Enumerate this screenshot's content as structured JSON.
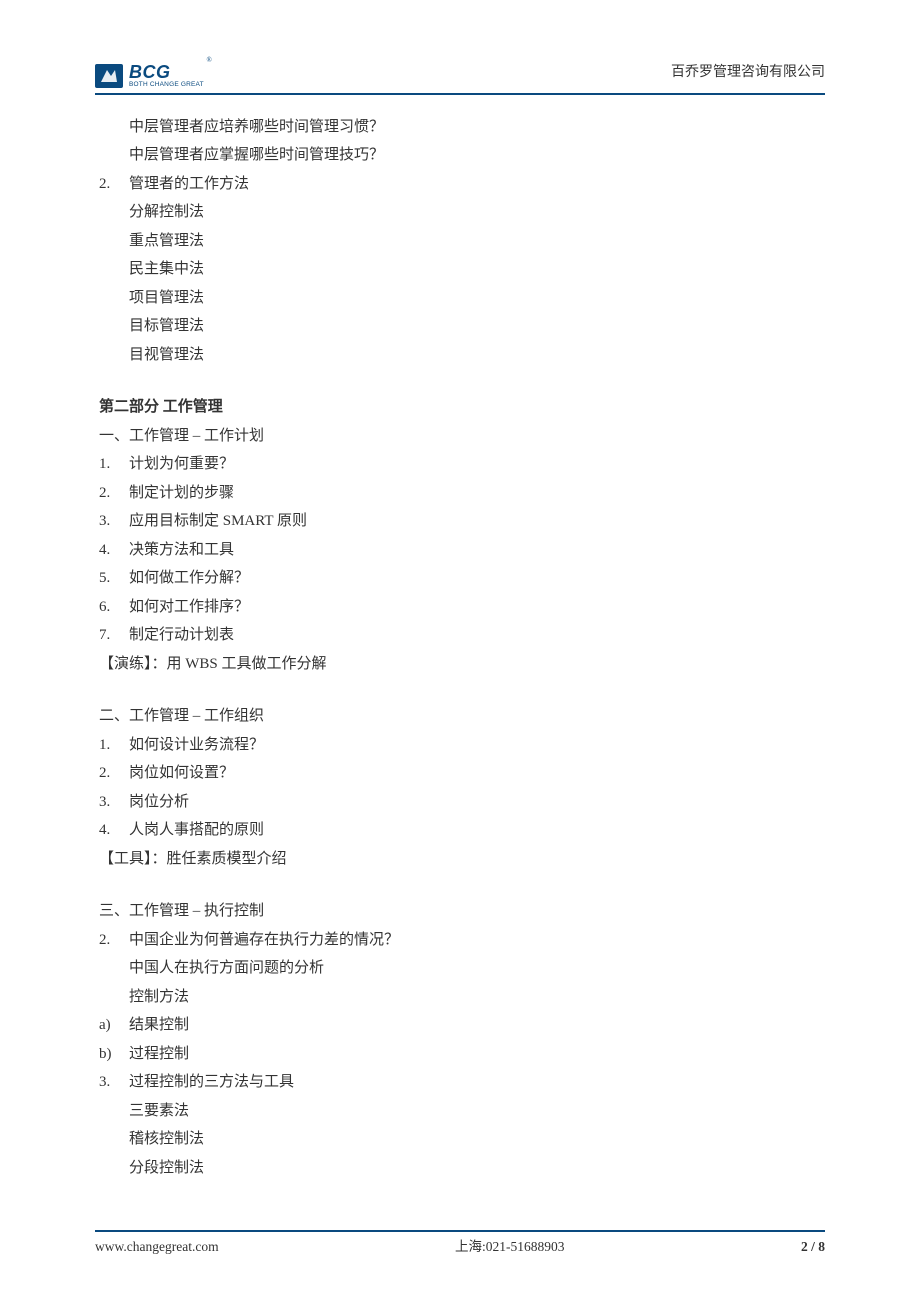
{
  "header": {
    "logo_top": "BCG",
    "logo_reg": "®",
    "logo_sub": "BOTH CHANGE GREAT",
    "company": "百乔罗管理咨询有限公司"
  },
  "body": {
    "pre_items": [
      "中层管理者应培养哪些时间管理习惯？",
      "中层管理者应掌握哪些时间管理技巧？"
    ],
    "item2_num": "2.",
    "item2_title": "管理者的工作方法",
    "item2_sub": [
      "分解控制法",
      "重点管理法",
      "民主集中法",
      "项目管理法",
      "目标管理法",
      "目视管理法"
    ],
    "part2_title": "第二部分  工作管理",
    "part2_a_title": "一、工作管理  –  工作计划",
    "part2_a_items": [
      {
        "n": "1.",
        "t": "计划为何重要？"
      },
      {
        "n": "2.",
        "t": "制定计划的步骤"
      },
      {
        "n": "3.",
        "t": "应用目标制定 SMART 原则"
      },
      {
        "n": "4.",
        "t": "决策方法和工具"
      },
      {
        "n": "5.",
        "t": "如何做工作分解？"
      },
      {
        "n": "6.",
        "t": "如何对工作排序？"
      },
      {
        "n": "7.",
        "t": "制定行动计划表"
      }
    ],
    "part2_a_note": "【演练】：用 WBS 工具做工作分解",
    "part2_b_title": "二、工作管理  –  工作组织",
    "part2_b_items": [
      {
        "n": "1.",
        "t": "如何设计业务流程？"
      },
      {
        "n": "2.",
        "t": "岗位如何设置？"
      },
      {
        "n": "3.",
        "t": "岗位分析"
      },
      {
        "n": "4.",
        "t": "人岗人事搭配的原则"
      }
    ],
    "part2_b_note": "【工具】：胜任素质模型介绍",
    "part2_c_title": "三、工作管理  –  执行控制",
    "part2_c_lead_num": "2.",
    "part2_c_lead": "中国企业为何普遍存在执行力差的情况？",
    "part2_c_lead_sub": [
      "中国人在执行方面问题的分析",
      "控制方法"
    ],
    "part2_c_ab": [
      {
        "n": "a)",
        "t": "结果控制"
      },
      {
        "n": "b)",
        "t": "过程控制"
      }
    ],
    "part2_c_item3_num": "3.",
    "part2_c_item3_title": "过程控制的三方法与工具",
    "part2_c_item3_sub": [
      "三要素法",
      "稽核控制法",
      "分段控制法"
    ]
  },
  "footer": {
    "url": "www.changegreat.com",
    "center": "上海:021-51688903",
    "page_cur": "2",
    "page_sep": " / ",
    "page_total": "8"
  }
}
